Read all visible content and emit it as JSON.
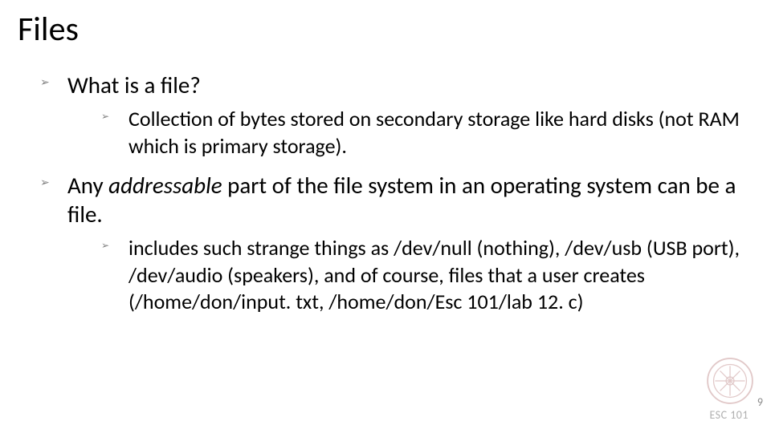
{
  "title": "Files",
  "bullets": {
    "b1": "What is a file?",
    "b1_1_a": "Collection of bytes stored on ",
    "b1_1_em": "secondary storage",
    "b1_1_b": " like hard disks (not RAM which is primary storage).",
    "b2_a": "Any ",
    "b2_em": "addressable",
    "b2_b": " part of the file system in an operating system can be a file.",
    "b2_1": "includes such strange things as /dev/null (nothing), /dev/usb (USB port), /dev/audio (speakers), and of course, files  that a user creates (/home/don/input. txt, /home/don/Esc 101/lab 12. c)"
  },
  "footer": {
    "label": "ESC 101",
    "page": "9"
  }
}
